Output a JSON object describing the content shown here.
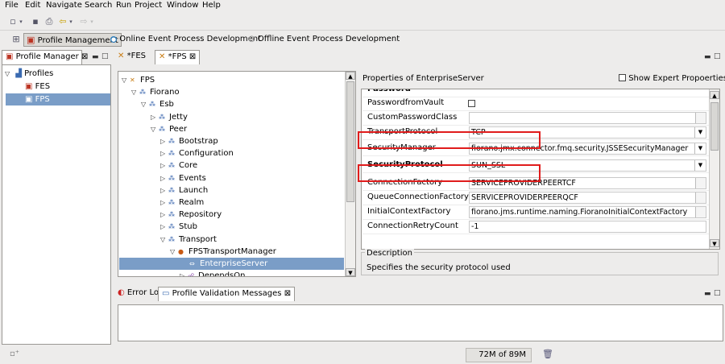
{
  "menu": [
    "File",
    "Edit",
    "Navigate",
    "Search",
    "Run",
    "Project",
    "Window",
    "Help"
  ],
  "perspectives": [
    {
      "label": "Profile Management",
      "active": true
    },
    {
      "label": "Online Event Process Development",
      "active": false
    },
    {
      "label": "Offline Event Process Development",
      "active": false
    }
  ],
  "profile_manager": {
    "tab_label": "Profile Manager",
    "close": "⊠",
    "tree": [
      {
        "label": "Profiles",
        "level": 0,
        "expanded": true
      },
      {
        "label": "FES",
        "level": 1
      },
      {
        "label": "FPS",
        "level": 1,
        "selected": true
      }
    ]
  },
  "editor_tabs": [
    {
      "label": "*FES",
      "active": false
    },
    {
      "label": "*FPS",
      "active": true,
      "close": "⊠"
    }
  ],
  "tree": [
    {
      "label": "FPS",
      "level": 0,
      "toggle": "open",
      "icon": "fps"
    },
    {
      "label": "Fiorano",
      "level": 1,
      "toggle": "open",
      "icon": "node"
    },
    {
      "label": "Esb",
      "level": 2,
      "toggle": "open",
      "icon": "node"
    },
    {
      "label": "Jetty",
      "level": 3,
      "toggle": "closed",
      "icon": "node"
    },
    {
      "label": "Peer",
      "level": 3,
      "toggle": "open",
      "icon": "node"
    },
    {
      "label": "Bootstrap",
      "level": 4,
      "toggle": "closed",
      "icon": "node"
    },
    {
      "label": "Configuration",
      "level": 4,
      "toggle": "closed",
      "icon": "node"
    },
    {
      "label": "Core",
      "level": 4,
      "toggle": "closed",
      "icon": "node"
    },
    {
      "label": "Events",
      "level": 4,
      "toggle": "closed",
      "icon": "node"
    },
    {
      "label": "Launch",
      "level": 4,
      "toggle": "closed",
      "icon": "node"
    },
    {
      "label": "Realm",
      "level": 4,
      "toggle": "closed",
      "icon": "node"
    },
    {
      "label": "Repository",
      "level": 4,
      "toggle": "closed",
      "icon": "node"
    },
    {
      "label": "Stub",
      "level": 4,
      "toggle": "closed",
      "icon": "node"
    },
    {
      "label": "Transport",
      "level": 4,
      "toggle": "open",
      "icon": "node"
    },
    {
      "label": "FPSTransportManager",
      "level": 5,
      "toggle": "open",
      "icon": "manager"
    },
    {
      "label": "EnterpriseServer",
      "level": 6,
      "toggle": "",
      "icon": "server",
      "selected": true
    },
    {
      "label": "DependsOn",
      "level": 6,
      "toggle": "closed",
      "icon": "depends"
    }
  ],
  "properties": {
    "title": "Properties of EnterpriseServer",
    "expert_label": "Show Expert Propoerties",
    "password_value": "- - - - - - - -",
    "rows": [
      {
        "name": "Password",
        "value": "- - - - - - - -",
        "kind": "text",
        "bold": true
      },
      {
        "name": "PasswordfromVault",
        "value": "",
        "kind": "checkbox"
      },
      {
        "name": "CustomPasswordClass",
        "value": "",
        "kind": "ellipsis"
      },
      {
        "name": "TransportProtocol",
        "value": "TCP",
        "kind": "dropdown"
      },
      {
        "name": "SecurityManager",
        "value": "fiorano.jmx.connector.fmq.security.JSSESecurityManager",
        "kind": "dropdown"
      },
      {
        "name": "SecurityProtocol",
        "value": "SUN_SSL",
        "kind": "dropdown",
        "bold": true
      },
      {
        "name": "ConnectionFactory",
        "value": "SERVICEPROVIDERPEERTCF",
        "kind": "ellipsis"
      },
      {
        "name": "QueueConnectionFactory",
        "value": "SERVICEPROVIDERPEERQCF",
        "kind": "ellipsis"
      },
      {
        "name": "InitialContextFactory",
        "value": "fiorano.jms.runtime.naming.FioranoInitialContextFactory",
        "kind": "ellipsis"
      },
      {
        "name": "ConnectionRetryCount",
        "value": "-1",
        "kind": "text"
      }
    ],
    "description_label": "Description",
    "description_text": "Specifies the security protocol used"
  },
  "bottom_tabs": [
    {
      "label": "Error Log",
      "active": false
    },
    {
      "label": "Profile Validation Messages",
      "active": true,
      "close": "⊠"
    }
  ],
  "status": {
    "memory": "72M of 89M"
  },
  "colors": {
    "highlight_red": "#e01c1c",
    "selection_blue": "#7a9dc7"
  }
}
